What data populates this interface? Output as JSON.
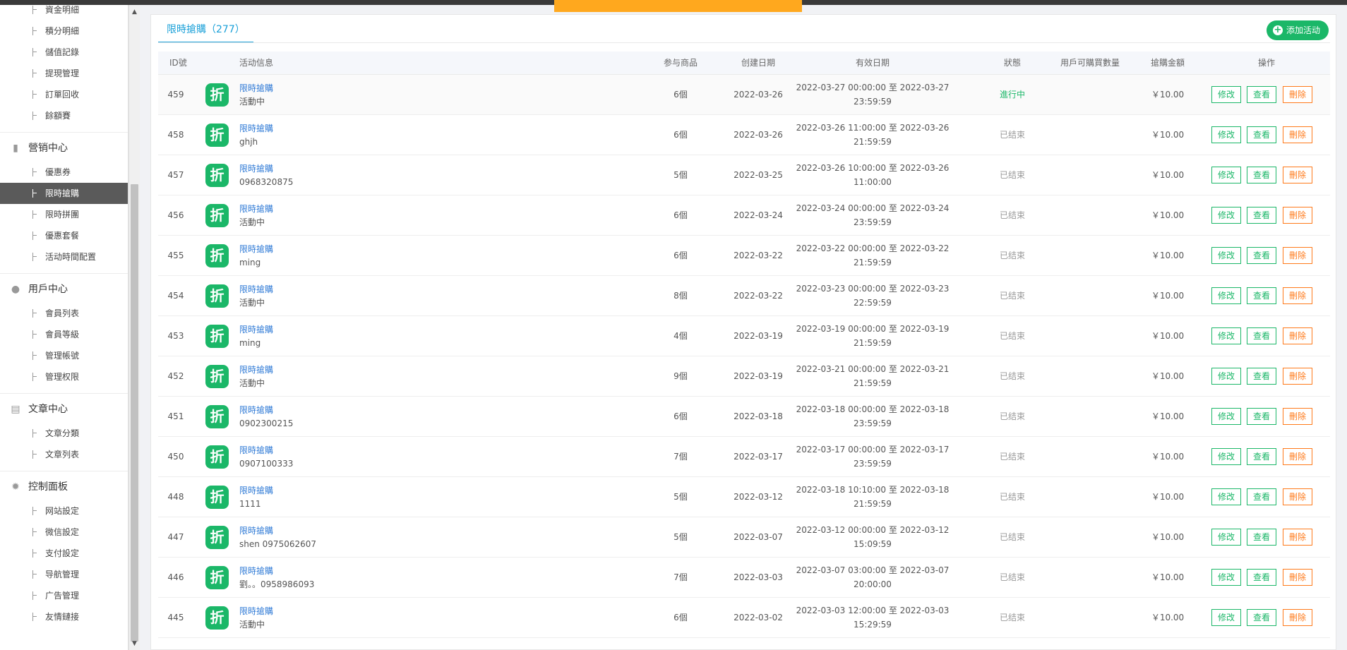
{
  "topbar": {
    "links": [
      "",
      "",
      "",
      "",
      "",
      ""
    ]
  },
  "sidebar": {
    "items_top": [
      {
        "label": "資金明細"
      },
      {
        "label": "積分明細"
      },
      {
        "label": "儲值記錄"
      },
      {
        "label": "提現管理"
      },
      {
        "label": "訂單回收"
      },
      {
        "label": "餘額賽"
      }
    ],
    "groups": [
      {
        "label": "營销中心",
        "icon": "chart-icon",
        "items": [
          {
            "label": "優惠券"
          },
          {
            "label": "限時搶購"
          },
          {
            "label": "限時拼團"
          },
          {
            "label": "優惠套餐"
          },
          {
            "label": "活动時間配置"
          }
        ]
      },
      {
        "label": "用戶中心",
        "icon": "user-icon",
        "items": [
          {
            "label": "會員列表"
          },
          {
            "label": "會員等級"
          },
          {
            "label": "管理帳號"
          },
          {
            "label": "管理权限"
          }
        ]
      },
      {
        "label": "文章中心",
        "icon": "document-icon",
        "items": [
          {
            "label": "文章分類"
          },
          {
            "label": "文章列表"
          }
        ]
      },
      {
        "label": "控制面板",
        "icon": "gear-icon",
        "items": [
          {
            "label": "网站設定"
          },
          {
            "label": "微信設定"
          },
          {
            "label": "支付設定"
          },
          {
            "label": "导航管理"
          },
          {
            "label": "广告管理"
          },
          {
            "label": "友情鏈接"
          }
        ]
      }
    ],
    "active_item": "限時搶購"
  },
  "main": {
    "tab_label": "限時搶購（277）",
    "add_button": "添加活动",
    "columns": [
      "ID號",
      "活动信息",
      "参与商品",
      "创建日期",
      "有效日期",
      "狀態",
      "用戶可購買數量",
      "搶購金額",
      "操作"
    ],
    "action_labels": {
      "edit": "修改",
      "view": "查看",
      "delete": "刪除"
    },
    "rows": [
      {
        "id": "459",
        "title": "限時搶購",
        "sub": "活動中",
        "goods": "6個",
        "created": "2022-03-26",
        "valid1": "2022-03-27 00:00:00 至 2022-03-27",
        "valid2": "23:59:59",
        "status": "進行中",
        "limit": "",
        "price": "￥10.00"
      },
      {
        "id": "458",
        "title": "限時搶購",
        "sub": "ghjh",
        "goods": "6個",
        "created": "2022-03-26",
        "valid1": "2022-03-26 11:00:00 至 2022-03-26",
        "valid2": "21:59:59",
        "status": "已结束",
        "limit": "",
        "price": "￥10.00"
      },
      {
        "id": "457",
        "title": "限時搶購",
        "sub": "0968320875",
        "goods": "5個",
        "created": "2022-03-25",
        "valid1": "2022-03-26 10:00:00 至 2022-03-26",
        "valid2": "11:00:00",
        "status": "已结束",
        "limit": "",
        "price": "￥10.00"
      },
      {
        "id": "456",
        "title": "限時搶購",
        "sub": "活動中",
        "goods": "6個",
        "created": "2022-03-24",
        "valid1": "2022-03-24 00:00:00 至 2022-03-24",
        "valid2": "23:59:59",
        "status": "已结束",
        "limit": "",
        "price": "￥10.00"
      },
      {
        "id": "455",
        "title": "限時搶購",
        "sub": "ming",
        "goods": "6個",
        "created": "2022-03-22",
        "valid1": "2022-03-22 00:00:00 至 2022-03-22",
        "valid2": "21:59:59",
        "status": "已结束",
        "limit": "",
        "price": "￥10.00"
      },
      {
        "id": "454",
        "title": "限時搶購",
        "sub": "活動中",
        "goods": "8個",
        "created": "2022-03-22",
        "valid1": "2022-03-23 00:00:00 至 2022-03-23",
        "valid2": "22:59:59",
        "status": "已结束",
        "limit": "",
        "price": "￥10.00"
      },
      {
        "id": "453",
        "title": "限時搶購",
        "sub": "ming",
        "goods": "4個",
        "created": "2022-03-19",
        "valid1": "2022-03-19 00:00:00 至 2022-03-19",
        "valid2": "21:59:59",
        "status": "已结束",
        "limit": "",
        "price": "￥10.00"
      },
      {
        "id": "452",
        "title": "限時搶購",
        "sub": "活動中",
        "goods": "9個",
        "created": "2022-03-19",
        "valid1": "2022-03-21 00:00:00 至 2022-03-21",
        "valid2": "21:59:59",
        "status": "已结束",
        "limit": "",
        "price": "￥10.00"
      },
      {
        "id": "451",
        "title": "限時搶購",
        "sub": "0902300215",
        "goods": "6個",
        "created": "2022-03-18",
        "valid1": "2022-03-18 00:00:00 至 2022-03-18",
        "valid2": "23:59:59",
        "status": "已结束",
        "limit": "",
        "price": "￥10.00"
      },
      {
        "id": "450",
        "title": "限時搶購",
        "sub": "0907100333",
        "goods": "7個",
        "created": "2022-03-17",
        "valid1": "2022-03-17 00:00:00 至 2022-03-17",
        "valid2": "23:59:59",
        "status": "已结束",
        "limit": "",
        "price": "￥10.00"
      },
      {
        "id": "448",
        "title": "限時搶購",
        "sub": "1111",
        "goods": "5個",
        "created": "2022-03-12",
        "valid1": "2022-03-18 10:10:00 至 2022-03-18",
        "valid2": "21:59:59",
        "status": "已结束",
        "limit": "",
        "price": "￥10.00"
      },
      {
        "id": "447",
        "title": "限時搶購",
        "sub": "shen 0975062607",
        "goods": "5個",
        "created": "2022-03-07",
        "valid1": "2022-03-12 00:00:00 至 2022-03-12",
        "valid2": "15:09:59",
        "status": "已结束",
        "limit": "",
        "price": "￥10.00"
      },
      {
        "id": "446",
        "title": "限時搶購",
        "sub": "劉。。0958986093",
        "goods": "7個",
        "created": "2022-03-03",
        "valid1": "2022-03-07 03:00:00 至 2022-03-07",
        "valid2": "20:00:00",
        "status": "已结束",
        "limit": "",
        "price": "￥10.00"
      },
      {
        "id": "445",
        "title": "限時搶購",
        "sub": "活動中",
        "goods": "6個",
        "created": "2022-03-02",
        "valid1": "2022-03-03 12:00:00 至 2022-03-03",
        "valid2": "15:29:59",
        "status": "已结束",
        "limit": "",
        "price": "￥10.00"
      }
    ],
    "row_icon_glyph": "折"
  }
}
